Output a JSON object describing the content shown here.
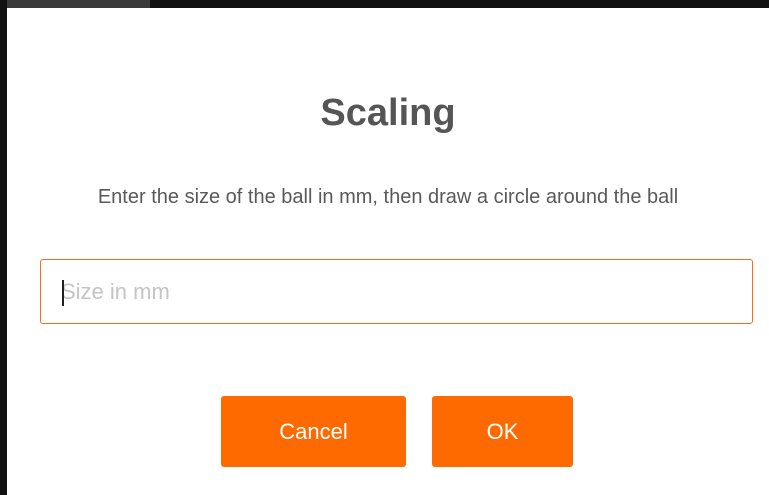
{
  "dialog": {
    "title": "Scaling",
    "message": "Enter the size of the ball in mm, then draw a circle around the ball",
    "size_input": {
      "value": "",
      "placeholder": "Size in mm"
    },
    "buttons": {
      "cancel_label": "Cancel",
      "ok_label": "OK"
    }
  },
  "colors": {
    "accent": "#ff6a00",
    "input_border": "#ff6b1a",
    "title_text": "#555555",
    "message_text": "#595959",
    "placeholder_text": "#c4c4c4"
  }
}
